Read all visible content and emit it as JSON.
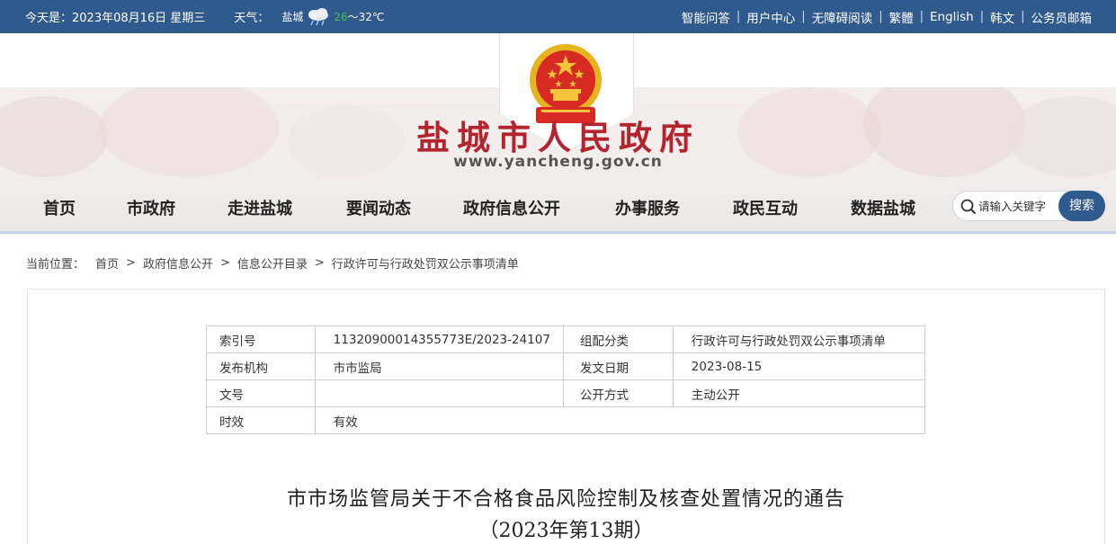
{
  "topbar": {
    "date": "今天是：2023年08月16日 星期三",
    "weather_label": "天气：",
    "city": "盐城",
    "temp_low": "26",
    "temp_high": "～32℃",
    "links": [
      "智能问答",
      "用户中心",
      "无障碍阅读",
      "繁體",
      "English",
      "韩文",
      "公务员邮箱"
    ]
  },
  "header": {
    "title": "盐城市人民政府",
    "url": "www.yancheng.gov.cn"
  },
  "nav": {
    "items": [
      "首页",
      "市政府",
      "走进盐城",
      "要闻动态",
      "政府信息公开",
      "办事服务",
      "政民互动",
      "数据盐城"
    ]
  },
  "search": {
    "placeholder": "请输入关键字",
    "button": "搜索"
  },
  "breadcrumb": {
    "label": "当前位置：",
    "items": [
      "首页",
      "政府信息公开",
      "信息公开目录",
      "行政许可与行政处罚双公示事项清单"
    ],
    "sep": ">"
  },
  "meta": {
    "index_label": "索引号",
    "index_value": "11320900014355773E/2023-24107",
    "category_label": "组配分类",
    "category_value": "行政许可与行政处罚双公示事项清单",
    "publisher_label": "发布机构",
    "publisher_value": "市市监局",
    "date_label": "发文日期",
    "date_value": "2023-08-15",
    "docno_label": "文号",
    "docno_value": "",
    "mode_label": "公开方式",
    "mode_value": "主动公开",
    "validity_label": "时效",
    "validity_value": "有效"
  },
  "document": {
    "title": "市市场监管局关于不合格食品风险控制及核查处置情况的通告",
    "subtitle": "（2023年第13期）"
  },
  "colors": {
    "brand_blue": "#2f5a8e",
    "title_red": "#b3242f"
  }
}
